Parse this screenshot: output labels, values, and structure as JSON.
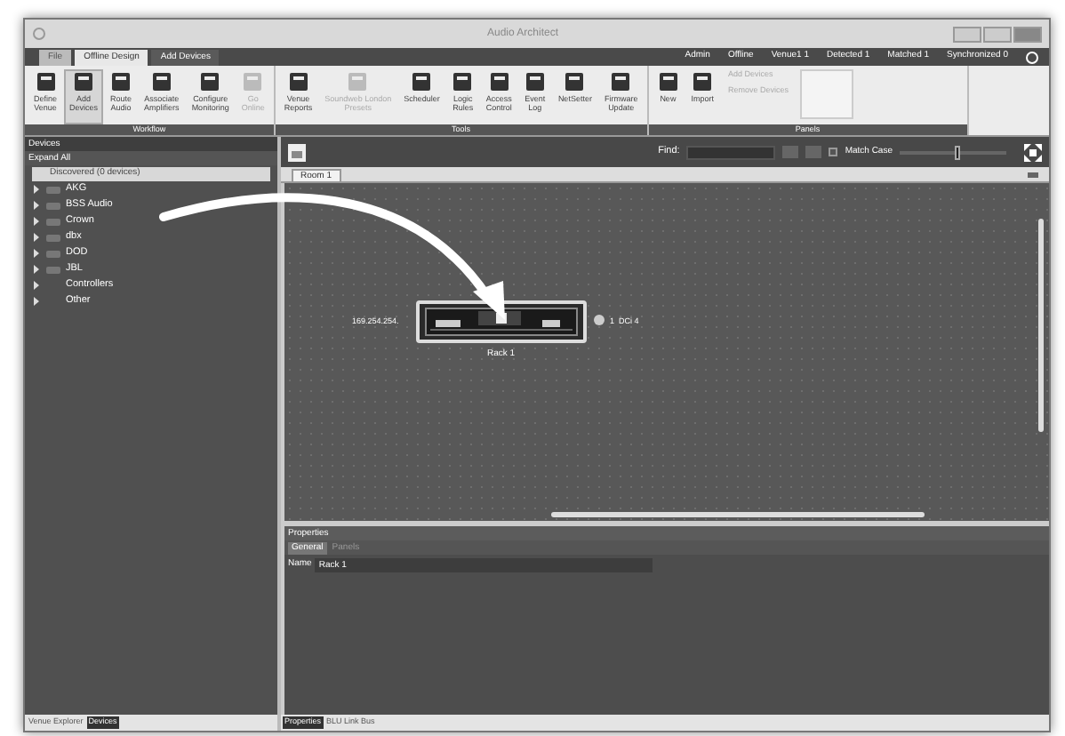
{
  "window": {
    "title": "Audio Architect"
  },
  "menu_tabs": [
    {
      "label": "File",
      "selected": false
    },
    {
      "label": "Offline Design",
      "selected": true
    },
    {
      "label": "Add Devices",
      "selected": false
    }
  ],
  "status_items": [
    "Admin",
    "Offline",
    "Venue1 1",
    "Detected 1",
    "Matched 1",
    "Synchronized 0"
  ],
  "ribbon_groups": [
    {
      "label": "Workflow",
      "buttons": [
        {
          "label": "Define\nVenue",
          "selected": false,
          "disabled": false
        },
        {
          "label": "Add\nDevices",
          "selected": true,
          "disabled": false
        },
        {
          "label": "Route\nAudio",
          "selected": false,
          "disabled": false
        },
        {
          "label": "Associate\nAmplifiers",
          "selected": false,
          "disabled": false
        },
        {
          "label": "Configure\nMonitoring",
          "selected": false,
          "disabled": false
        },
        {
          "label": "Go\nOnline",
          "selected": false,
          "disabled": true
        }
      ]
    },
    {
      "label": "Tools",
      "buttons": [
        {
          "label": "Venue\nReports",
          "selected": false,
          "disabled": false
        },
        {
          "label": "Soundweb London\nPresets",
          "selected": false,
          "disabled": true
        },
        {
          "label": "Scheduler",
          "selected": false,
          "disabled": false
        },
        {
          "label": "Logic\nRules",
          "selected": false,
          "disabled": false
        },
        {
          "label": "Access\nControl",
          "selected": false,
          "disabled": false
        },
        {
          "label": "Event\nLog",
          "selected": false,
          "disabled": false
        },
        {
          "label": "NetSetter",
          "selected": false,
          "disabled": false
        },
        {
          "label": "Firmware\nUpdate",
          "selected": false,
          "disabled": false
        }
      ]
    },
    {
      "label": "Panels",
      "buttons": [
        {
          "label": "New",
          "selected": false,
          "disabled": false
        },
        {
          "label": "Import",
          "selected": false,
          "disabled": false
        }
      ],
      "side_items": [
        {
          "label": "Add Devices",
          "disabled": true
        },
        {
          "label": "Remove Devices",
          "disabled": true
        }
      ]
    }
  ],
  "devices_panel": {
    "title": "Devices",
    "expand_all": "Expand All",
    "discovered": {
      "label": "Discovered (0 devices)",
      "selected": true
    },
    "tree": [
      {
        "label": "AKG",
        "expanded": false,
        "selected": false
      },
      {
        "label": "BSS Audio",
        "expanded": false,
        "selected": false
      },
      {
        "label": "Crown",
        "expanded": false,
        "selected": false
      },
      {
        "label": "dbx",
        "expanded": false,
        "selected": false
      },
      {
        "label": "DOD",
        "expanded": false,
        "selected": false
      },
      {
        "label": "JBL",
        "expanded": false,
        "selected": false
      },
      {
        "label": "Controllers",
        "expanded": false,
        "selected": false
      },
      {
        "label": "Other",
        "expanded": false,
        "selected": false
      }
    ]
  },
  "toolbar": {
    "find_label": "Find:",
    "match_case": {
      "label": "Match Case",
      "checked": false
    },
    "zoom": {
      "level": 0.55
    }
  },
  "room_tabs": [
    {
      "label": "Room 1",
      "selected": true
    }
  ],
  "canvas": {
    "device": {
      "name": "Rack 1",
      "address": "169.254.254.",
      "output": "1  DCi 4"
    }
  },
  "properties": {
    "title": "Properties",
    "tabs": [
      {
        "label": "General",
        "selected": true
      },
      {
        "label": "Panels",
        "selected": false
      }
    ],
    "name_label": "Name",
    "name_value": "Rack 1"
  },
  "left_tabs": [
    {
      "label": "Venue Explorer",
      "selected": false
    },
    {
      "label": "Devices",
      "selected": true
    }
  ],
  "right_tabs": [
    {
      "label": "Properties",
      "selected": true
    },
    {
      "label": "BLU Link Bus",
      "selected": false
    }
  ]
}
